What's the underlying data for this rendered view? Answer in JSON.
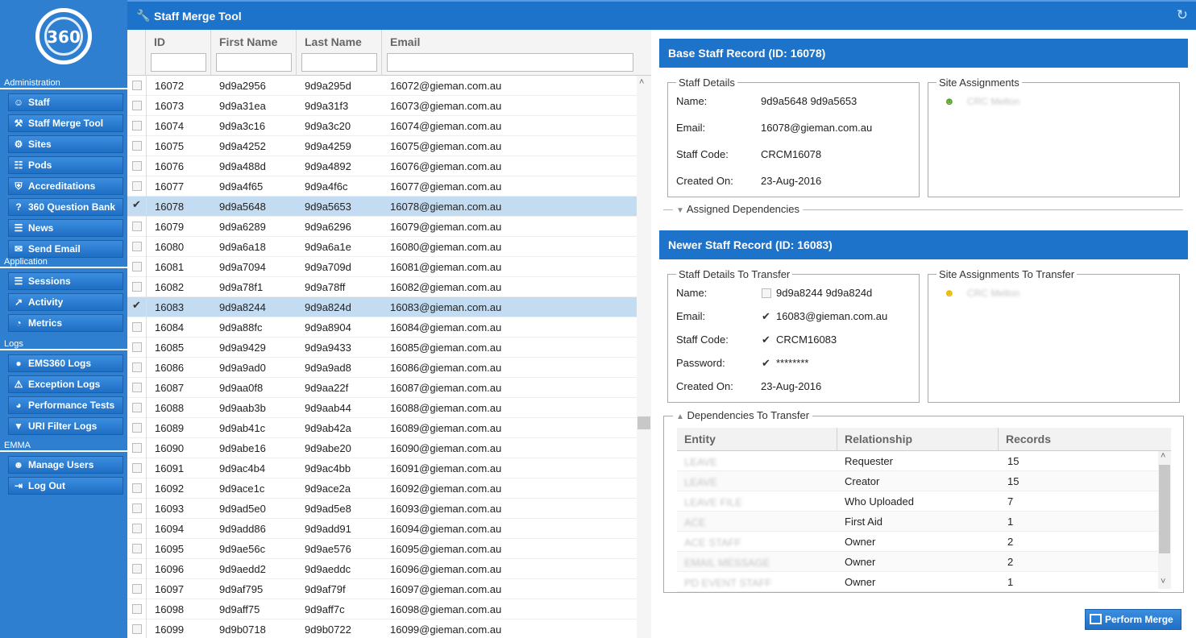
{
  "app": {
    "title": "Staff Merge Tool",
    "logo_text": "360"
  },
  "sidebar": {
    "sections": [
      {
        "header": "Administration",
        "items": [
          {
            "label": "Staff",
            "icon": "users-icon"
          },
          {
            "label": "Staff Merge Tool",
            "icon": "wrench-icon"
          },
          {
            "label": "Sites",
            "icon": "gears-icon"
          },
          {
            "label": "Pods",
            "icon": "sitemap-icon"
          },
          {
            "label": "Accreditations",
            "icon": "shield-icon"
          },
          {
            "label": "360 Question Bank",
            "icon": "question-icon"
          },
          {
            "label": "News",
            "icon": "newspaper-icon"
          },
          {
            "label": "Send Email",
            "icon": "envelope-icon"
          }
        ]
      },
      {
        "header": "Application",
        "items": [
          {
            "label": "Sessions",
            "icon": "id-card-icon"
          },
          {
            "label": "Activity",
            "icon": "line-chart-icon"
          },
          {
            "label": "Metrics",
            "icon": "dashboard-icon"
          }
        ]
      },
      {
        "header": "Logs",
        "items": [
          {
            "label": "EMS360 Logs",
            "icon": "globe-icon"
          },
          {
            "label": "Exception Logs",
            "icon": "warning-icon"
          },
          {
            "label": "Performance Tests",
            "icon": "speedometer-icon"
          },
          {
            "label": "URI Filter Logs",
            "icon": "filter-icon"
          }
        ]
      },
      {
        "header": "EMMA",
        "items": [
          {
            "label": "Manage Users",
            "icon": "user-circle-icon"
          },
          {
            "label": "Log Out",
            "icon": "sign-out-icon"
          }
        ]
      }
    ]
  },
  "grid": {
    "columns": {
      "id": "ID",
      "first": "First Name",
      "last": "Last Name",
      "email": "Email"
    },
    "rows": [
      {
        "id": "16072",
        "first": "9d9a2956",
        "last": "9d9a295d",
        "email": "16072@gieman.com.au",
        "checked": false
      },
      {
        "id": "16073",
        "first": "9d9a31ea",
        "last": "9d9a31f3",
        "email": "16073@gieman.com.au",
        "checked": false
      },
      {
        "id": "16074",
        "first": "9d9a3c16",
        "last": "9d9a3c20",
        "email": "16074@gieman.com.au",
        "checked": false
      },
      {
        "id": "16075",
        "first": "9d9a4252",
        "last": "9d9a4259",
        "email": "16075@gieman.com.au",
        "checked": false
      },
      {
        "id": "16076",
        "first": "9d9a488d",
        "last": "9d9a4892",
        "email": "16076@gieman.com.au",
        "checked": false
      },
      {
        "id": "16077",
        "first": "9d9a4f65",
        "last": "9d9a4f6c",
        "email": "16077@gieman.com.au",
        "checked": false
      },
      {
        "id": "16078",
        "first": "9d9a5648",
        "last": "9d9a5653",
        "email": "16078@gieman.com.au",
        "checked": true
      },
      {
        "id": "16079",
        "first": "9d9a6289",
        "last": "9d9a6296",
        "email": "16079@gieman.com.au",
        "checked": false
      },
      {
        "id": "16080",
        "first": "9d9a6a18",
        "last": "9d9a6a1e",
        "email": "16080@gieman.com.au",
        "checked": false
      },
      {
        "id": "16081",
        "first": "9d9a7094",
        "last": "9d9a709d",
        "email": "16081@gieman.com.au",
        "checked": false
      },
      {
        "id": "16082",
        "first": "9d9a78f1",
        "last": "9d9a78ff",
        "email": "16082@gieman.com.au",
        "checked": false
      },
      {
        "id": "16083",
        "first": "9d9a8244",
        "last": "9d9a824d",
        "email": "16083@gieman.com.au",
        "checked": true
      },
      {
        "id": "16084",
        "first": "9d9a88fc",
        "last": "9d9a8904",
        "email": "16084@gieman.com.au",
        "checked": false
      },
      {
        "id": "16085",
        "first": "9d9a9429",
        "last": "9d9a9433",
        "email": "16085@gieman.com.au",
        "checked": false
      },
      {
        "id": "16086",
        "first": "9d9a9ad0",
        "last": "9d9a9ad8",
        "email": "16086@gieman.com.au",
        "checked": false
      },
      {
        "id": "16087",
        "first": "9d9aa0f8",
        "last": "9d9aa22f",
        "email": "16087@gieman.com.au",
        "checked": false
      },
      {
        "id": "16088",
        "first": "9d9aab3b",
        "last": "9d9aab44",
        "email": "16088@gieman.com.au",
        "checked": false
      },
      {
        "id": "16089",
        "first": "9d9ab41c",
        "last": "9d9ab42a",
        "email": "16089@gieman.com.au",
        "checked": false
      },
      {
        "id": "16090",
        "first": "9d9abe16",
        "last": "9d9abe20",
        "email": "16090@gieman.com.au",
        "checked": false
      },
      {
        "id": "16091",
        "first": "9d9ac4b4",
        "last": "9d9ac4bb",
        "email": "16091@gieman.com.au",
        "checked": false
      },
      {
        "id": "16092",
        "first": "9d9ace1c",
        "last": "9d9ace2a",
        "email": "16092@gieman.com.au",
        "checked": false
      },
      {
        "id": "16093",
        "first": "9d9ad5e0",
        "last": "9d9ad5e8",
        "email": "16093@gieman.com.au",
        "checked": false
      },
      {
        "id": "16094",
        "first": "9d9add86",
        "last": "9d9add91",
        "email": "16094@gieman.com.au",
        "checked": false
      },
      {
        "id": "16095",
        "first": "9d9ae56c",
        "last": "9d9ae576",
        "email": "16095@gieman.com.au",
        "checked": false
      },
      {
        "id": "16096",
        "first": "9d9aedd2",
        "last": "9d9aeddc",
        "email": "16096@gieman.com.au",
        "checked": false
      },
      {
        "id": "16097",
        "first": "9d9af795",
        "last": "9d9af79f",
        "email": "16097@gieman.com.au",
        "checked": false
      },
      {
        "id": "16098",
        "first": "9d9aff75",
        "last": "9d9aff7c",
        "email": "16098@gieman.com.au",
        "checked": false
      },
      {
        "id": "16099",
        "first": "9d9b0718",
        "last": "9d9b0722",
        "email": "16099@gieman.com.au",
        "checked": false
      }
    ]
  },
  "base": {
    "title": "Base Staff Record (ID: 16078)",
    "details_legend": "Staff Details",
    "name_label": "Name:",
    "name": "9d9a5648 9d9a5653",
    "email_label": "Email:",
    "email": "16078@gieman.com.au",
    "code_label": "Staff Code:",
    "code": "CRCM16078",
    "created_label": "Created On:",
    "created": "23-Aug-2016",
    "sites_legend": "Site Assignments",
    "site": "CRC Melton",
    "site_icon_color": "#5aa02c",
    "deps_label": "Assigned Dependencies"
  },
  "newer": {
    "title": "Newer Staff Record (ID: 16083)",
    "details_legend": "Staff Details To Transfer",
    "name_label": "Name:",
    "name": "9d9a8244 9d9a824d",
    "name_checked": false,
    "email_label": "Email:",
    "email": "16083@gieman.com.au",
    "email_checked": true,
    "code_label": "Staff Code:",
    "code": "CRCM16083",
    "code_checked": true,
    "password_label": "Password:",
    "password": "********",
    "password_checked": true,
    "created_label": "Created On:",
    "created": "23-Aug-2016",
    "sites_legend": "Site Assignments To Transfer",
    "site": "CRC Melton",
    "site_icon_color": "#e6b800"
  },
  "dependencies": {
    "label": "Dependencies To Transfer",
    "columns": {
      "entity": "Entity",
      "relationship": "Relationship",
      "records": "Records"
    },
    "rows": [
      {
        "entity": "LEAVE",
        "relationship": "Requester",
        "records": "15"
      },
      {
        "entity": "LEAVE",
        "relationship": "Creator",
        "records": "15"
      },
      {
        "entity": "LEAVE FILE",
        "relationship": "Who Uploaded",
        "records": "7"
      },
      {
        "entity": "ACE",
        "relationship": "First Aid",
        "records": "1"
      },
      {
        "entity": "ACE STAFF",
        "relationship": "Owner",
        "records": "2"
      },
      {
        "entity": "EMAIL MESSAGE",
        "relationship": "Owner",
        "records": "2"
      },
      {
        "entity": "PD EVENT STAFF",
        "relationship": "Owner",
        "records": "1"
      }
    ]
  },
  "actions": {
    "merge": "Perform Merge"
  },
  "colors": {
    "brand": "#1d72c9",
    "sidebar": "#2f7fd1",
    "selected_row": "#c3dcf2"
  }
}
